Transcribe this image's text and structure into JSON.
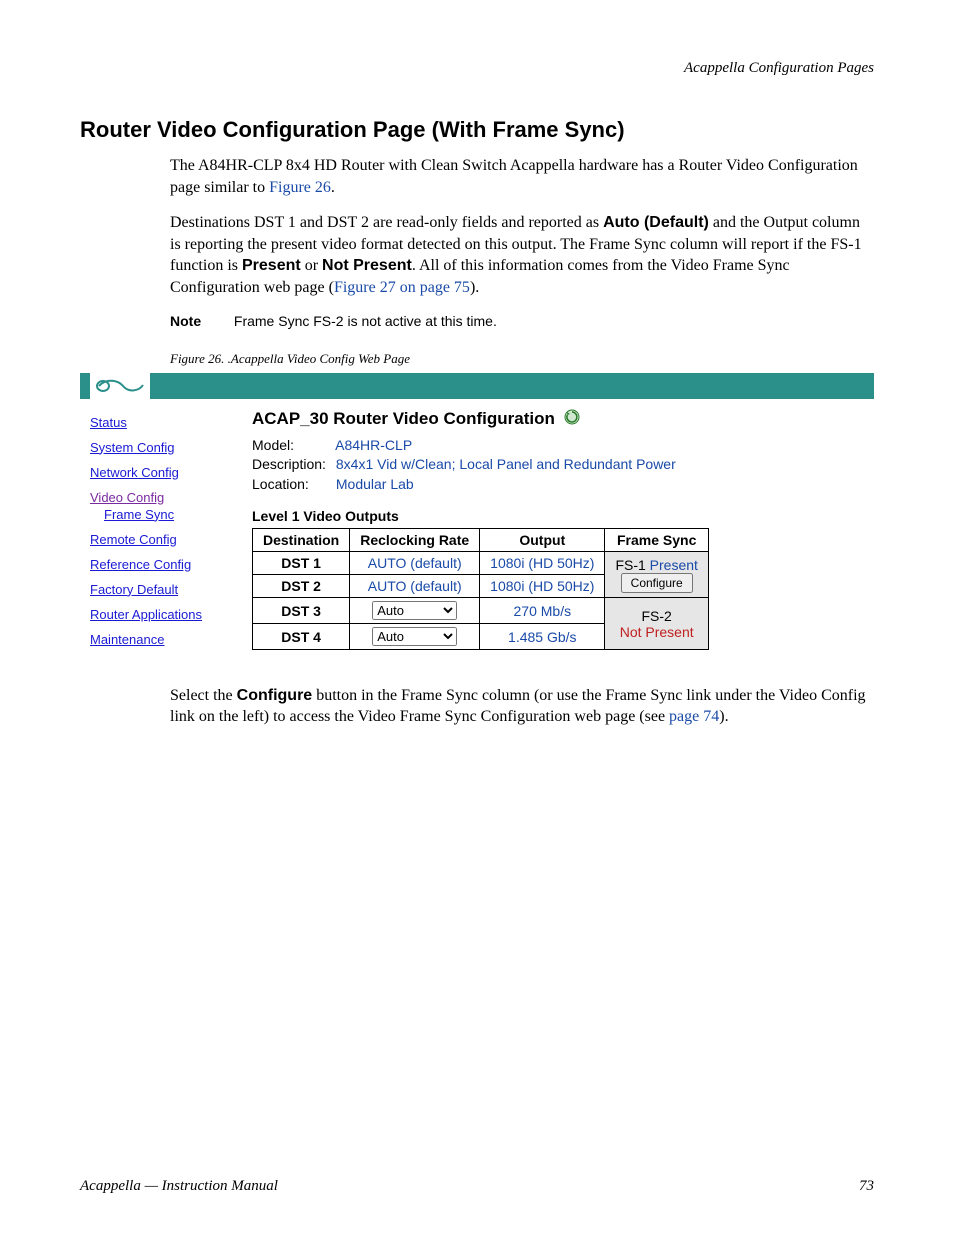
{
  "header": {
    "right": "Acappella Configuration Pages"
  },
  "title": "Router Video Configuration Page (With Frame Sync)",
  "para1": {
    "t1": "The A84HR-CLP 8x4 HD Router with Clean Switch Acappella hardware has a Router Video Configuration page similar to ",
    "link": "Figure 26",
    "t2": "."
  },
  "para2": {
    "t1": "Destinations DST 1 and DST 2 are read-only fields and reported as ",
    "b1": "Auto (Default)",
    "t2": " and the Output column is reporting the present video format detected on this output. The Frame Sync column will report if the FS-1 function is ",
    "b2": "Present",
    "t3": " or ",
    "b3": "Not Present",
    "t4": ". All of this information comes from the Video Frame Sync Configuration web page (",
    "link": "Figure 27 on page 75",
    "t5": ")."
  },
  "note": {
    "label": "Note",
    "text": "Frame Sync FS-2 is not active at this time."
  },
  "figure_caption": "Figure 26.  .Acappella Video Config Web Page",
  "webui": {
    "nav": {
      "status": "Status",
      "system": "System Config",
      "network": "Network Config",
      "video": "Video Config",
      "frame_sync": "Frame Sync",
      "remote": "Remote Config",
      "reference": "Reference Config",
      "factory": "Factory Default",
      "router_apps": "Router Applications",
      "maintenance": "Maintenance"
    },
    "title_prefix": "ACAP_30",
    "title_main": "  Router Video Configuration",
    "info": {
      "model_label": "Model:",
      "model_value": "A84HR-CLP",
      "desc_label": "Description:",
      "desc_value": "8x4x1 Vid w/Clean; Local Panel and Redundant Power",
      "loc_label": "Location:",
      "loc_value": "Modular Lab"
    },
    "subhead": "Level 1 Video Outputs",
    "table": {
      "headers": {
        "dest": "Destination",
        "reclock": "Reclocking Rate",
        "output": "Output",
        "fs": "Frame Sync"
      },
      "rows": [
        {
          "dest": "DST 1",
          "reclock": "AUTO (default)",
          "output": "1080i (HD 50Hz)",
          "select": false
        },
        {
          "dest": "DST 2",
          "reclock": "AUTO (default)",
          "output": "1080i (HD 50Hz)",
          "select": false
        },
        {
          "dest": "DST 3",
          "reclock": "Auto",
          "output": "270 Mb/s",
          "select": true
        },
        {
          "dest": "DST 4",
          "reclock": "Auto",
          "output": "1.485 Gb/s",
          "select": true
        }
      ],
      "fs1_label": "FS-1 ",
      "fs1_status": "Present",
      "configure_btn": "Configure",
      "fs2_label": "FS-2",
      "fs2_status": "Not Present"
    }
  },
  "para3": {
    "t1": "Select the ",
    "b1": "Configure",
    "t2": " button in the Frame Sync column (or use the Frame Sync link under the Video Config link on the left) to access the Video Frame Sync Configuration web page (see ",
    "link": "page 74",
    "t3": ")."
  },
  "footer": {
    "left": "Acappella  —  Instruction Manual",
    "right": "73"
  }
}
